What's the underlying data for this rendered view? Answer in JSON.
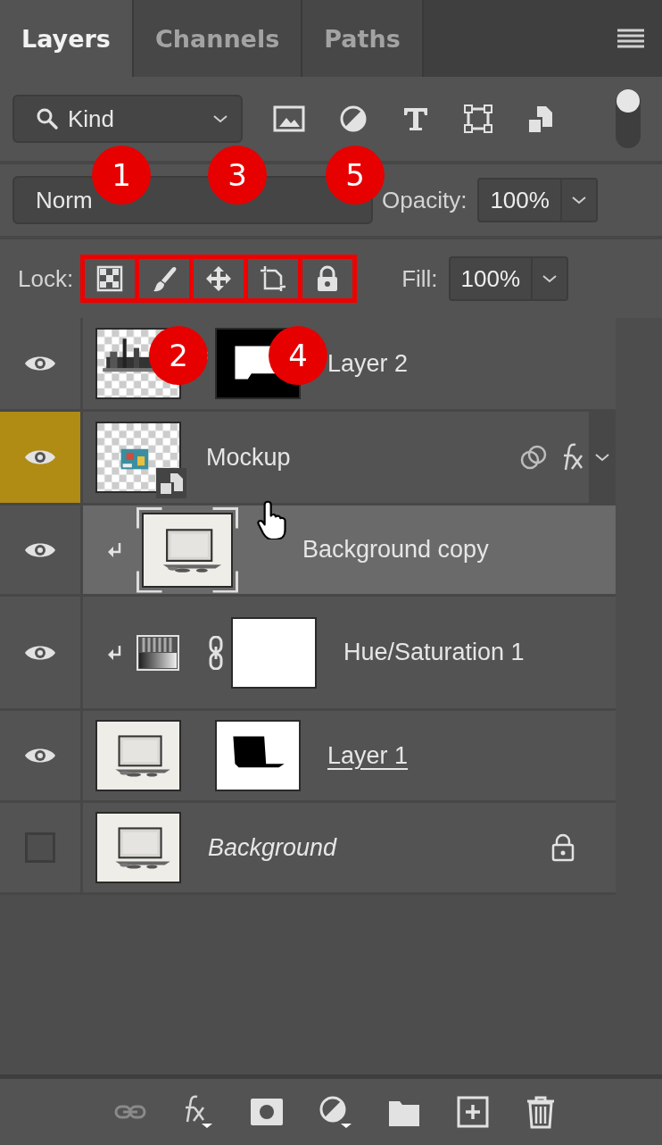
{
  "tabs": [
    {
      "label": "Layers",
      "selected": true
    },
    {
      "label": "Channels",
      "selected": false
    },
    {
      "label": "Paths",
      "selected": false
    }
  ],
  "filter": {
    "kind": "Kind",
    "on": true
  },
  "blend": {
    "mode": "Norm",
    "opacity_label": "Opacity:",
    "opacity": "100%"
  },
  "lock": {
    "label": "Lock:",
    "fill_label": "Fill:",
    "fill": "100%"
  },
  "callouts": [
    {
      "label": "1"
    },
    {
      "label": "2"
    },
    {
      "label": "3"
    },
    {
      "label": "4"
    },
    {
      "label": "5"
    }
  ],
  "layers": [
    {
      "name": "Layer 2",
      "kind": "pixel",
      "visible": true,
      "selected": false,
      "eye_highlighted": false,
      "clipped": false,
      "mask": true,
      "underlined": false,
      "effects": false
    },
    {
      "name": "Mockup",
      "kind": "smart",
      "visible": true,
      "selected": false,
      "eye_highlighted": true,
      "clipped": false,
      "mask": false,
      "underlined": false,
      "effects": true
    },
    {
      "name": "Background copy",
      "kind": "pixel",
      "visible": true,
      "selected": true,
      "eye_highlighted": false,
      "clipped": true,
      "mask": false,
      "underlined": false,
      "effects": false
    },
    {
      "name": "Hue/Saturation 1",
      "kind": "adjustment",
      "visible": true,
      "selected": false,
      "eye_highlighted": false,
      "clipped": true,
      "mask": true,
      "underlined": false,
      "effects": false
    },
    {
      "name": "Layer 1",
      "kind": "pixel",
      "visible": true,
      "selected": false,
      "eye_highlighted": false,
      "clipped": false,
      "mask": true,
      "underlined": true,
      "effects": false
    },
    {
      "name": "Background",
      "kind": "background",
      "visible": false,
      "selected": false,
      "eye_highlighted": false,
      "clipped": false,
      "mask": false,
      "underlined": false,
      "effects": false
    }
  ]
}
